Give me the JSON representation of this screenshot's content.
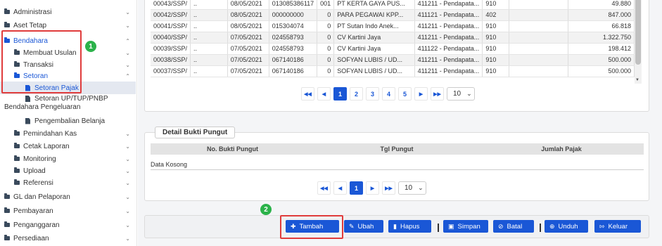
{
  "sidebar": {
    "administrasi": "Administrasi",
    "aset_tetap": "Aset Tetap",
    "bendahara": "Bendahara",
    "membuat_usulan": "Membuat Usulan",
    "transaksi": "Transaksi",
    "setoran": "Setoran",
    "setoran_pajak": "Setoran Pajak",
    "setoran_up_line1": "Setoran UP/TUP/PNBP",
    "setoran_up_line2": "Bendahara Pengeluaran",
    "pengembalian_belanja": "Pengembalian Belanja",
    "pemindahan_kas": "Pemindahan Kas",
    "cetak_laporan": "Cetak Laporan",
    "monitoring": "Monitoring",
    "upload": "Upload",
    "referensi": "Referensi",
    "gl_pelaporan": "GL dan Pelaporan",
    "pembayaran": "Pembayaran",
    "penganggaran": "Penganggaran",
    "persediaan": "Persediaan"
  },
  "annotations": {
    "badge1": "1",
    "badge2": "2"
  },
  "rows": [
    {
      "no": "00043/SSP/",
      "dot": "..",
      "tgl": "08/05/2021",
      "npwp": "013085386117",
      "suffix": "001",
      "name": "PT KERTA GAYA PUS...",
      "akun": "411211 - Pendapata...",
      "kode": "910",
      "jumlah": "49.880"
    },
    {
      "no": "00042/SSP/",
      "dot": "..",
      "tgl": "08/05/2021",
      "npwp": "000000000",
      "suffix": "0",
      "name": "PARA PEGAWAI KPP...",
      "akun": "411121 - Pendapata...",
      "kode": "402",
      "jumlah": "847.000"
    },
    {
      "no": "00041/SSP/",
      "dot": "..",
      "tgl": "08/05/2021",
      "npwp": "015304074",
      "suffix": "0",
      "name": "PT Sutan Indo Anek...",
      "akun": "411211 - Pendapata...",
      "kode": "910",
      "jumlah": "66.818"
    },
    {
      "no": "00040/SSP/",
      "dot": "..",
      "tgl": "07/05/2021",
      "npwp": "024558793",
      "suffix": "0",
      "name": "CV Kartini Jaya",
      "akun": "411211 - Pendapata...",
      "kode": "910",
      "jumlah": "1.322.750"
    },
    {
      "no": "00039/SSP/",
      "dot": "..",
      "tgl": "07/05/2021",
      "npwp": "024558793",
      "suffix": "0",
      "name": "CV Kartini Jaya",
      "akun": "411122 - Pendapata...",
      "kode": "910",
      "jumlah": "198.412"
    },
    {
      "no": "00038/SSP/",
      "dot": "..",
      "tgl": "07/05/2021",
      "npwp": "067140186",
      "suffix": "0",
      "name": "SOFYAN LUBIS / UD...",
      "akun": "411211 - Pendapata...",
      "kode": "910",
      "jumlah": "500.000"
    },
    {
      "no": "00037/SSP/",
      "dot": "..",
      "tgl": "07/05/2021",
      "npwp": "067140186",
      "suffix": "0",
      "name": "SOFYAN LUBIS / UD...",
      "akun": "411211 - Pendapata...",
      "kode": "910",
      "jumlah": "500.000"
    }
  ],
  "pager1": {
    "pages": [
      "1",
      "2",
      "3",
      "4",
      "5"
    ],
    "size": "10"
  },
  "detail": {
    "title": "Detail Bukti Pungut",
    "col_no": "No. Bukti Pungut",
    "col_tgl": "Tgl Pungut",
    "col_jumlah": "Jumlah Pajak",
    "empty": "Data Kosong"
  },
  "pager2": {
    "page": "1",
    "size": "10"
  },
  "toolbar": {
    "tambah": "Tambah",
    "ubah": "Ubah",
    "hapus": "Hapus",
    "simpan": "Simpan",
    "batal": "Batal",
    "unduh": "Unduh",
    "keluar": "Keluar"
  }
}
